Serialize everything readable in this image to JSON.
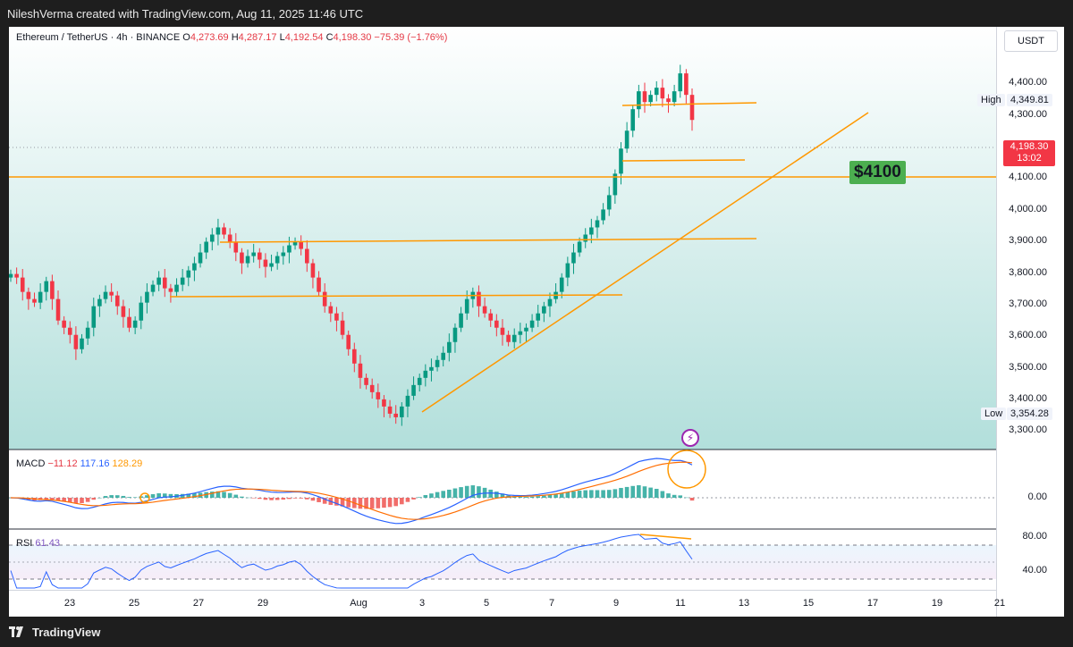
{
  "header": {
    "credit": "NileshVerma created with TradingView.com, Aug 11, 2025 11:46 UTC"
  },
  "footer": {
    "brand": "TradingView"
  },
  "colors": {
    "up": "#089981",
    "down": "#f23645",
    "annotation": "#ff9800",
    "bg_gradient_top": "#ffffff",
    "bg_gradient_bottom": "#b2dfdb",
    "note_bg": "#4caf50"
  },
  "legend": {
    "symbol": "Ethereum / TetherUS · 4h · BINANCE",
    "o_label": "O",
    "o": "4,273.69",
    "h_label": "H",
    "h": "4,287.17",
    "l_label": "L",
    "l": "4,192.54",
    "c_label": "C",
    "c": "4,198.30",
    "change": "−75.39 (−1.76%)"
  },
  "price_axis": {
    "currency": "USDT",
    "ticks": [
      "4,400.00",
      "4,300.00",
      "4,100.00",
      "4,000.00",
      "3,900.00",
      "3,800.00",
      "3,700.00",
      "3,600.00",
      "3,500.00",
      "3,400.00",
      "3,300.00"
    ],
    "high_label": "High",
    "high_value": "4,349.81",
    "low_label": "Low",
    "low_value": "3,354.28",
    "last_price": "4,198.30",
    "countdown": "13:02"
  },
  "macd": {
    "label": "MACD",
    "hist": "−11.12",
    "macd": "117.16",
    "signal": "128.29",
    "axis_tick": "0.00"
  },
  "rsi": {
    "label": "RSI",
    "value": "61.43",
    "ticks": [
      "80.00",
      "40.00"
    ]
  },
  "time_axis": {
    "labels": [
      "23",
      "25",
      "27",
      "29",
      "Aug",
      "3",
      "5",
      "7",
      "9",
      "11",
      "13",
      "15",
      "17",
      "19",
      "21"
    ]
  },
  "annotation": {
    "note": "$4100"
  },
  "chart_data": {
    "type": "candlestick",
    "symbol": "ETHUSDT",
    "interval": "4h",
    "exchange": "BINANCE",
    "ylim": [
      3280,
      4460
    ],
    "grid": false,
    "horizontal_levels": [
      4100,
      3910,
      3730
    ],
    "range_box": {
      "top": 4335,
      "bottom": 4160
    },
    "trendline": {
      "from": {
        "date": "Aug 3",
        "price": 3350
      },
      "to": {
        "date": "Aug 17",
        "price": 4310
      }
    },
    "last": {
      "open": 4273.69,
      "high": 4287.17,
      "low": 4192.54,
      "close": 4198.3,
      "change": -75.39,
      "change_pct": -1.76
    },
    "high": 4349.81,
    "low": 3354.28,
    "closes_approx": [
      3770,
      3760,
      3720,
      3700,
      3690,
      3720,
      3750,
      3700,
      3640,
      3620,
      3600,
      3560,
      3590,
      3620,
      3680,
      3700,
      3720,
      3710,
      3680,
      3650,
      3620,
      3640,
      3690,
      3720,
      3740,
      3760,
      3730,
      3720,
      3740,
      3760,
      3780,
      3800,
      3830,
      3860,
      3880,
      3900,
      3880,
      3860,
      3830,
      3800,
      3820,
      3830,
      3810,
      3790,
      3800,
      3820,
      3830,
      3850,
      3860,
      3840,
      3800,
      3760,
      3720,
      3680,
      3660,
      3640,
      3600,
      3560,
      3520,
      3480,
      3460,
      3440,
      3420,
      3400,
      3380,
      3370,
      3400,
      3430,
      3460,
      3480,
      3500,
      3510,
      3530,
      3550,
      3580,
      3620,
      3660,
      3700,
      3720,
      3680,
      3660,
      3640,
      3620,
      3600,
      3580,
      3600,
      3610,
      3620,
      3640,
      3660,
      3680,
      3700,
      3720,
      3760,
      3800,
      3830,
      3860,
      3880,
      3900,
      3920,
      3950,
      3990,
      4050,
      4120,
      4170,
      4230,
      4280,
      4250,
      4270,
      4290,
      4260,
      4250,
      4280,
      4330,
      4270,
      4200
    ],
    "macd_panel": {
      "hist": -11.12,
      "macd": 117.16,
      "signal": 128.29
    },
    "rsi_panel": {
      "rsi": 61.43,
      "bands": [
        80,
        40
      ]
    }
  }
}
